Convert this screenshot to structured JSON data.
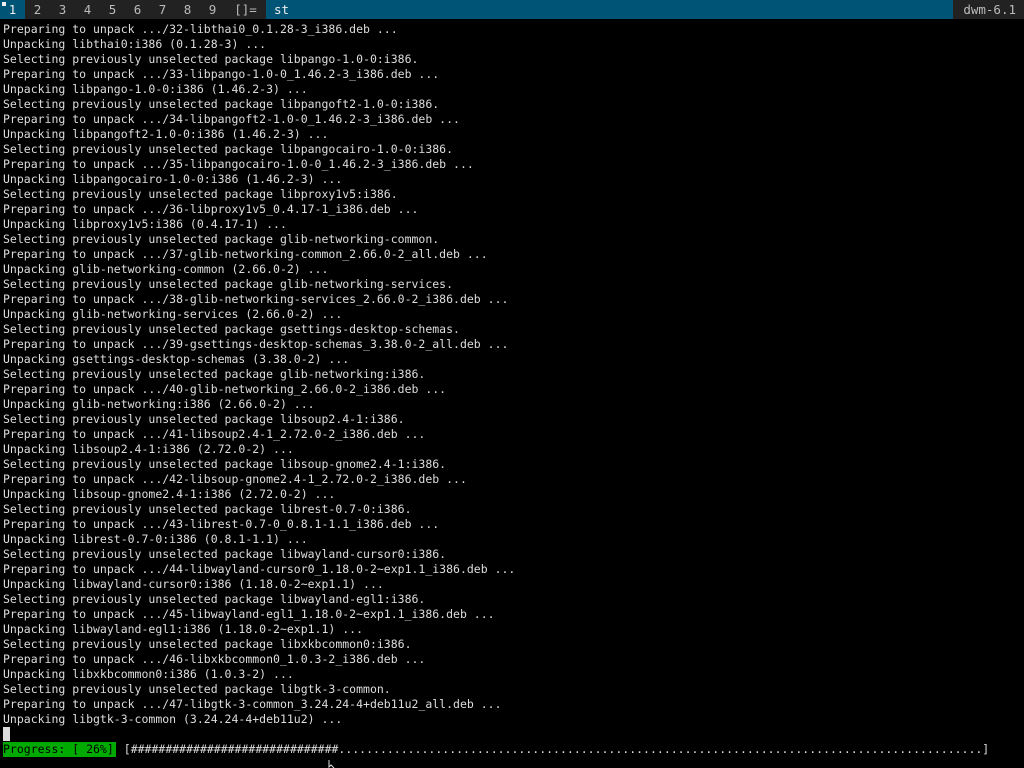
{
  "bar": {
    "tags": [
      "1",
      "2",
      "3",
      "4",
      "5",
      "6",
      "7",
      "8",
      "9"
    ],
    "selected_tag": "1",
    "layout": "[]=",
    "window_title": "st",
    "status": "dwm-6.1"
  },
  "terminal": {
    "lines": [
      "Preparing to unpack .../32-libthai0_0.1.28-3_i386.deb ...",
      "Unpacking libthai0:i386 (0.1.28-3) ...",
      "Selecting previously unselected package libpango-1.0-0:i386.",
      "Preparing to unpack .../33-libpango-1.0-0_1.46.2-3_i386.deb ...",
      "Unpacking libpango-1.0-0:i386 (1.46.2-3) ...",
      "Selecting previously unselected package libpangoft2-1.0-0:i386.",
      "Preparing to unpack .../34-libpangoft2-1.0-0_1.46.2-3_i386.deb ...",
      "Unpacking libpangoft2-1.0-0:i386 (1.46.2-3) ...",
      "Selecting previously unselected package libpangocairo-1.0-0:i386.",
      "Preparing to unpack .../35-libpangocairo-1.0-0_1.46.2-3_i386.deb ...",
      "Unpacking libpangocairo-1.0-0:i386 (1.46.2-3) ...",
      "Selecting previously unselected package libproxy1v5:i386.",
      "Preparing to unpack .../36-libproxy1v5_0.4.17-1_i386.deb ...",
      "Unpacking libproxy1v5:i386 (0.4.17-1) ...",
      "Selecting previously unselected package glib-networking-common.",
      "Preparing to unpack .../37-glib-networking-common_2.66.0-2_all.deb ...",
      "Unpacking glib-networking-common (2.66.0-2) ...",
      "Selecting previously unselected package glib-networking-services.",
      "Preparing to unpack .../38-glib-networking-services_2.66.0-2_i386.deb ...",
      "Unpacking glib-networking-services (2.66.0-2) ...",
      "Selecting previously unselected package gsettings-desktop-schemas.",
      "Preparing to unpack .../39-gsettings-desktop-schemas_3.38.0-2_all.deb ...",
      "Unpacking gsettings-desktop-schemas (3.38.0-2) ...",
      "Selecting previously unselected package glib-networking:i386.",
      "Preparing to unpack .../40-glib-networking_2.66.0-2_i386.deb ...",
      "Unpacking glib-networking:i386 (2.66.0-2) ...",
      "Selecting previously unselected package libsoup2.4-1:i386.",
      "Preparing to unpack .../41-libsoup2.4-1_2.72.0-2_i386.deb ...",
      "Unpacking libsoup2.4-1:i386 (2.72.0-2) ...",
      "Selecting previously unselected package libsoup-gnome2.4-1:i386.",
      "Preparing to unpack .../42-libsoup-gnome2.4-1_2.72.0-2_i386.deb ...",
      "Unpacking libsoup-gnome2.4-1:i386 (2.72.0-2) ...",
      "Selecting previously unselected package librest-0.7-0:i386.",
      "Preparing to unpack .../43-librest-0.7-0_0.8.1-1.1_i386.deb ...",
      "Unpacking librest-0.7-0:i386 (0.8.1-1.1) ...",
      "Selecting previously unselected package libwayland-cursor0:i386.",
      "Preparing to unpack .../44-libwayland-cursor0_1.18.0-2~exp1.1_i386.deb ...",
      "Unpacking libwayland-cursor0:i386 (1.18.0-2~exp1.1) ...",
      "Selecting previously unselected package libwayland-egl1:i386.",
      "Preparing to unpack .../45-libwayland-egl1_1.18.0-2~exp1.1_i386.deb ...",
      "Unpacking libwayland-egl1:i386 (1.18.0-2~exp1.1) ...",
      "Selecting previously unselected package libxkbcommon0:i386.",
      "Preparing to unpack .../46-libxkbcommon0_1.0.3-2_i386.deb ...",
      "Unpacking libxkbcommon0:i386 (1.0.3-2) ...",
      "Selecting previously unselected package libgtk-3-common.",
      "Preparing to unpack .../47-libgtk-3-common_3.24.24-4+deb11u2_all.deb ...",
      "Unpacking libgtk-3-common (3.24.24-4+deb11u2) ..."
    ]
  },
  "progress": {
    "label": "Progress: [ 26%]",
    "bar": "[##############################.............................................................................................]",
    "percent": 26
  },
  "colors": {
    "accent": "#005577",
    "bar_bg": "#222222",
    "progress_green": "#00aa00"
  }
}
